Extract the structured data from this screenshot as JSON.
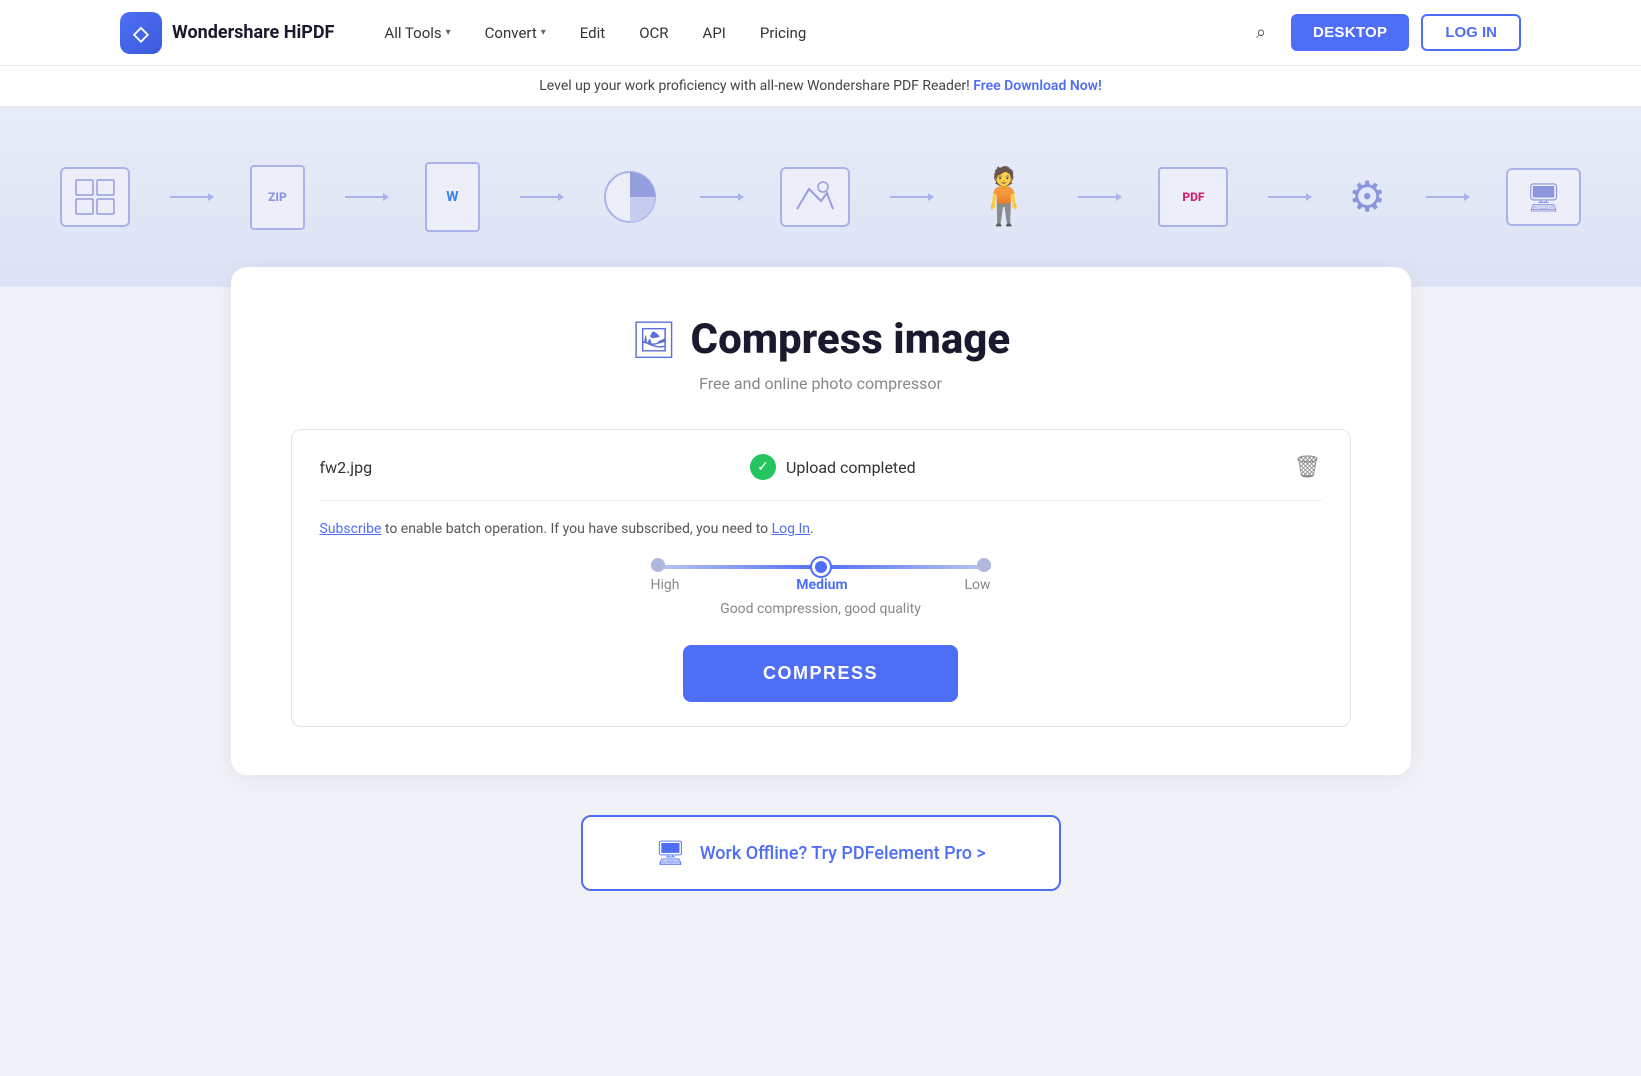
{
  "brand": {
    "logo_letter": "◇",
    "name": "Wondershare HiPDF"
  },
  "navbar": {
    "all_tools_label": "All Tools",
    "convert_label": "Convert",
    "edit_label": "Edit",
    "ocr_label": "OCR",
    "api_label": "API",
    "pricing_label": "Pricing",
    "desktop_label": "DESKTOP",
    "login_label": "LOG IN"
  },
  "announcement": {
    "text": "Level up your work proficiency with all-new Wondershare PDF Reader!",
    "link_text": "Free Download Now!"
  },
  "tool": {
    "icon": "🖼",
    "title": "Compress image",
    "subtitle": "Free and online photo compressor"
  },
  "upload": {
    "file_name": "fw2.jpg",
    "status_text": "Upload completed",
    "subscribe_text": "to enable batch operation. If you have subscribed, you need to",
    "subscribe_link": "Subscribe",
    "login_link": "Log In"
  },
  "compression": {
    "levels": [
      {
        "label": "High",
        "active": false
      },
      {
        "label": "Medium",
        "active": true
      },
      {
        "label": "Low",
        "active": false
      }
    ],
    "description": "Good compression, good quality",
    "button_label": "COMPRESS"
  },
  "offline": {
    "text": "Work Offline? Try PDFelement Pro >"
  }
}
